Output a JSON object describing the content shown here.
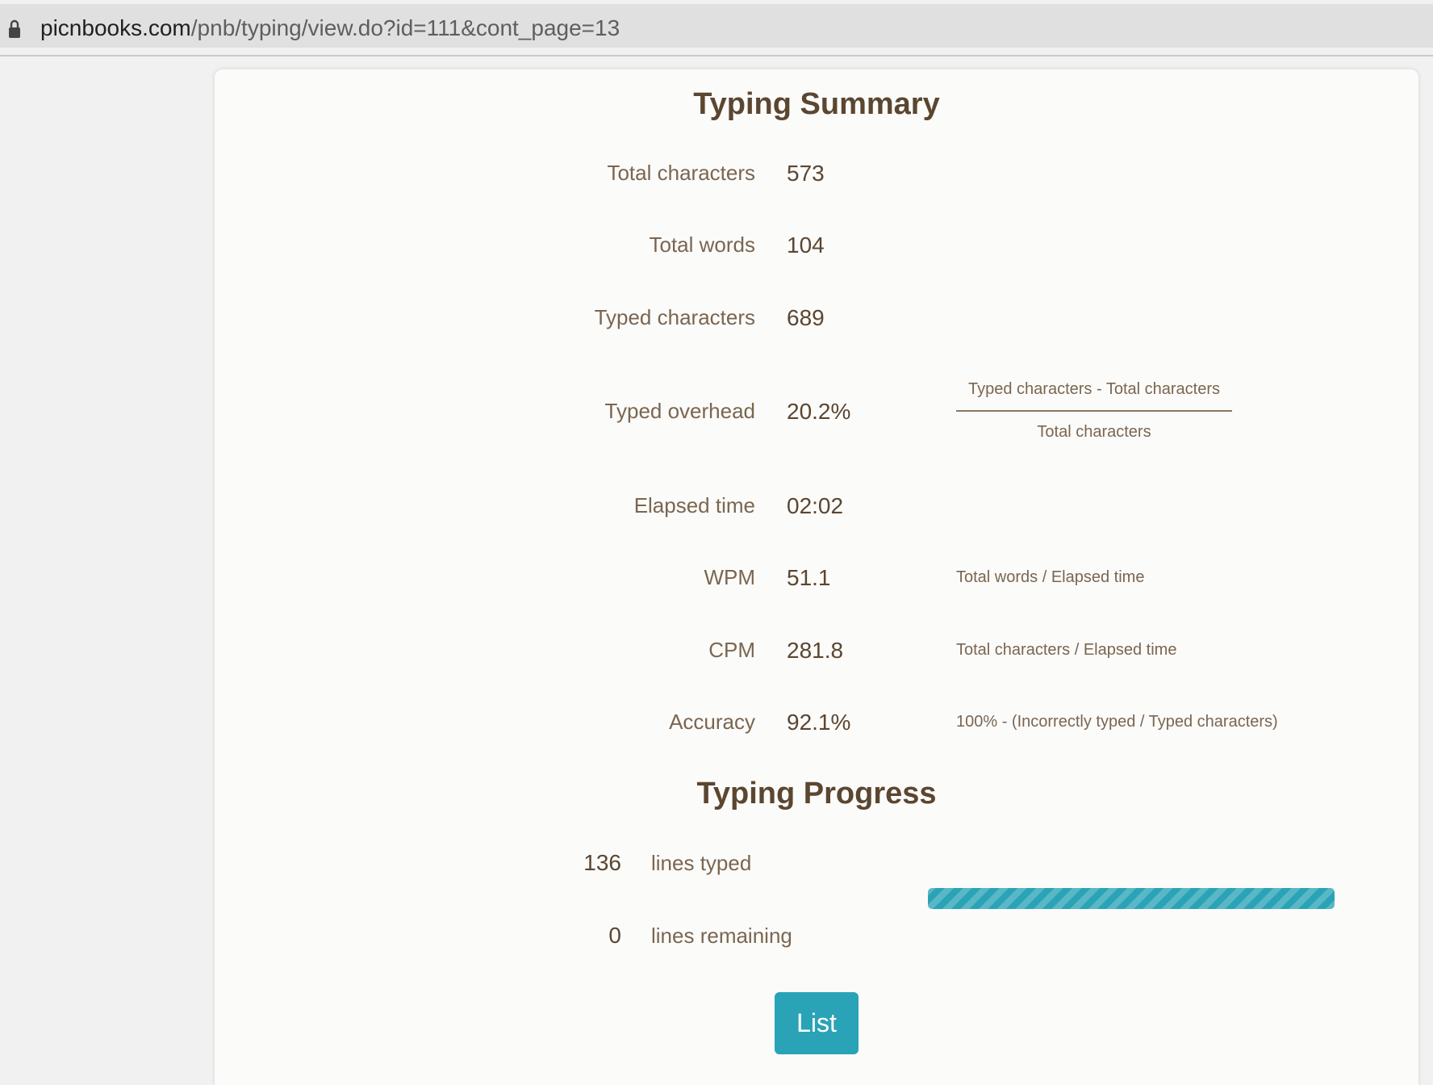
{
  "browser": {
    "url_domain": "picnbooks.com",
    "url_path": "/pnb/typing/view.do?id=111&cont_page=13"
  },
  "summary": {
    "title": "Typing Summary",
    "rows": [
      {
        "label": "Total characters",
        "value": "573",
        "formula": ""
      },
      {
        "label": "Total words",
        "value": "104",
        "formula": ""
      },
      {
        "label": "Typed characters",
        "value": "689",
        "formula": ""
      },
      {
        "label": "Typed overhead",
        "value": "20.2%",
        "formula_numerator": "Typed characters - Total characters",
        "formula_denominator": "Total characters"
      },
      {
        "label": "Elapsed time",
        "value": "02:02",
        "formula": ""
      },
      {
        "label": "WPM",
        "value": "51.1",
        "formula": "Total words / Elapsed time"
      },
      {
        "label": "CPM",
        "value": "281.8",
        "formula": "Total characters / Elapsed time"
      },
      {
        "label": "Accuracy",
        "value": "92.1%",
        "formula": "100% - (Incorrectly typed / Typed characters)"
      }
    ]
  },
  "progress": {
    "title": "Typing Progress",
    "lines_typed": "136",
    "lines_typed_label": "lines typed",
    "lines_remaining": "0",
    "lines_remaining_label": "lines remaining",
    "percent_complete": 100
  },
  "actions": {
    "list_label": "List"
  },
  "colors": {
    "accent": "#2aa3b6",
    "heading": "#5b4630",
    "label": "#7a6650"
  }
}
